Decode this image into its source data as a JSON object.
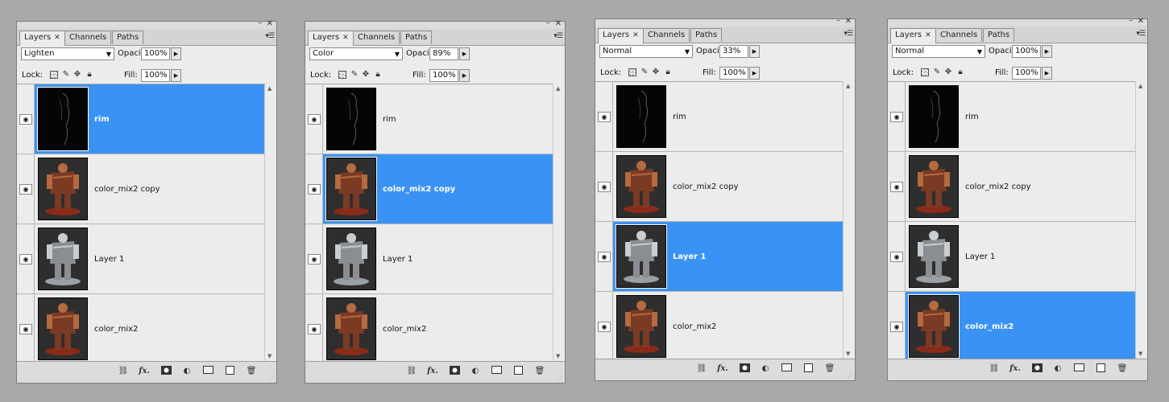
{
  "colors": {
    "selection": "#3a93f4",
    "panel_bg": "#ececec",
    "desktop_bg": "#a9a9a9"
  },
  "tabs": [
    "Layers",
    "Channels",
    "Paths"
  ],
  "labels": {
    "opacity": "Opacity:",
    "lock": "Lock:",
    "fill": "Fill:"
  },
  "icons": {
    "lock": [
      "lock-transparent-icon",
      "lock-paint-icon",
      "lock-move-icon",
      "lock-all-icon"
    ],
    "bottom": [
      "link-icon",
      "fx-icon",
      "mask-icon",
      "adjustment-icon",
      "folder-icon",
      "new-layer-icon",
      "trash-icon"
    ]
  },
  "panels": [
    {
      "blend_mode": "Lighten",
      "opacity": "100%",
      "fill": "100%",
      "selected_layer": 0,
      "layers": [
        "rim",
        "color_mix2 copy",
        "Layer 1",
        "color_mix2"
      ]
    },
    {
      "blend_mode": "Color",
      "opacity": "89%",
      "fill": "100%",
      "selected_layer": 1,
      "layers": [
        "rim",
        "color_mix2 copy",
        "Layer 1",
        "color_mix2"
      ]
    },
    {
      "blend_mode": "Normal",
      "opacity": "33%",
      "fill": "100%",
      "selected_layer": 2,
      "layers": [
        "rim",
        "color_mix2 copy",
        "Layer 1",
        "color_mix2"
      ]
    },
    {
      "blend_mode": "Normal",
      "opacity": "100%",
      "fill": "100%",
      "selected_layer": 3,
      "layers": [
        "rim",
        "color_mix2 copy",
        "Layer 1",
        "color_mix2"
      ]
    }
  ]
}
